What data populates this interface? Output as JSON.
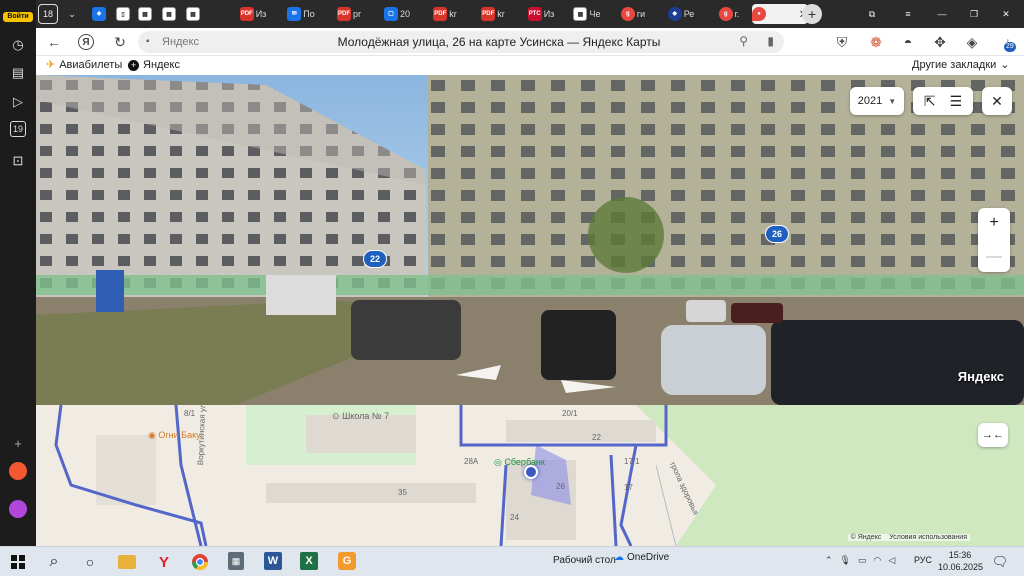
{
  "browser": {
    "tab_count": "18",
    "tabs": [
      {
        "title": "Из",
        "fav": "PDF",
        "color": "#d9342b"
      },
      {
        "title": "По",
        "fav": "✉",
        "color": "#1a73e8"
      },
      {
        "title": "pr",
        "fav": "PDF",
        "color": "#d9342b"
      },
      {
        "title": "20",
        "fav": "▢",
        "color": "#1a73e8"
      },
      {
        "title": "kr",
        "fav": "PDF",
        "color": "#d9342b"
      },
      {
        "title": "kr",
        "fav": "PDF",
        "color": "#d9342b"
      },
      {
        "title": "Из",
        "fav": "РТС",
        "color": "#c8102e"
      },
      {
        "title": "Че",
        "fav": "▦",
        "color": "#888888"
      },
      {
        "title": "ги",
        "fav": "g",
        "color": "#e8483f"
      },
      {
        "title": "Ре",
        "fav": "◆",
        "color": "#1c3f94"
      },
      {
        "title": "г.",
        "fav": "g",
        "color": "#e8483f"
      }
    ],
    "active_tab_title": "Молодёжная улица, 26 на карте Усинска — Яндекс Карты",
    "address_domain": "Яндекс",
    "page_title": "Молодёжная улица, 26 на карте Усинска — Яндекс Карты",
    "download_count": "29",
    "login_label": "Войти"
  },
  "bookmarks": {
    "items": [
      "Авиабилеты",
      "Яндекс"
    ],
    "other": "Другие закладки"
  },
  "panorama": {
    "year": "2021",
    "watermark": "Яндекс",
    "house_labels": [
      "22",
      "26"
    ]
  },
  "map": {
    "labels": {
      "ogni": "Огни Баку",
      "school": "Школа № 7",
      "sber": "Сбербанк",
      "street1": "Воркутинская ул.",
      "street2": "тропа здоровья",
      "house_81": "8/1",
      "house_201": "20/1",
      "house_22": "22",
      "house_28a": "28А",
      "house_171": "17/1",
      "house_35": "35",
      "house_24": "24",
      "house_26": "26",
      "house_17": "17"
    },
    "copyright": "© Яндекс",
    "terms": "Условия использования"
  },
  "taskbar": {
    "desktop": "Рабочий стол",
    "onedrive": "OneDrive",
    "lang": "РУС",
    "time": "15:36",
    "date": "10.06.2025"
  }
}
